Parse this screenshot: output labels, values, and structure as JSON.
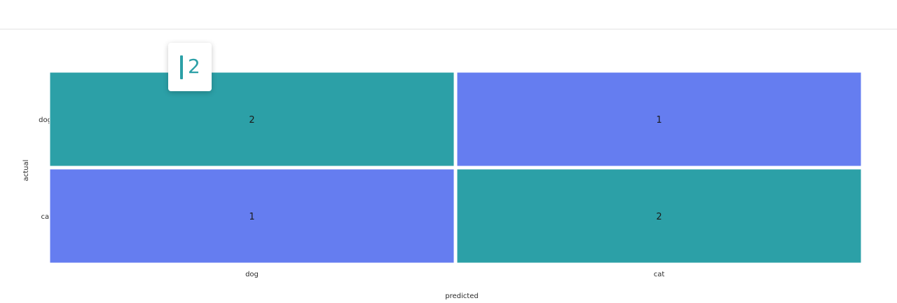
{
  "colors": {
    "high": "#2ca0a7",
    "low": "#657df0",
    "background": "#ffffff",
    "divider": "#e2e2e2"
  },
  "tooltip": {
    "value": "2"
  },
  "chart_data": {
    "type": "heatmap",
    "x_categories": [
      "dog",
      "cat"
    ],
    "y_categories": [
      "dog",
      "cat"
    ],
    "values": [
      [
        2,
        1
      ],
      [
        1,
        2
      ]
    ],
    "xlabel": "predicted",
    "ylabel": "actual",
    "legend": "none",
    "grid": false
  }
}
